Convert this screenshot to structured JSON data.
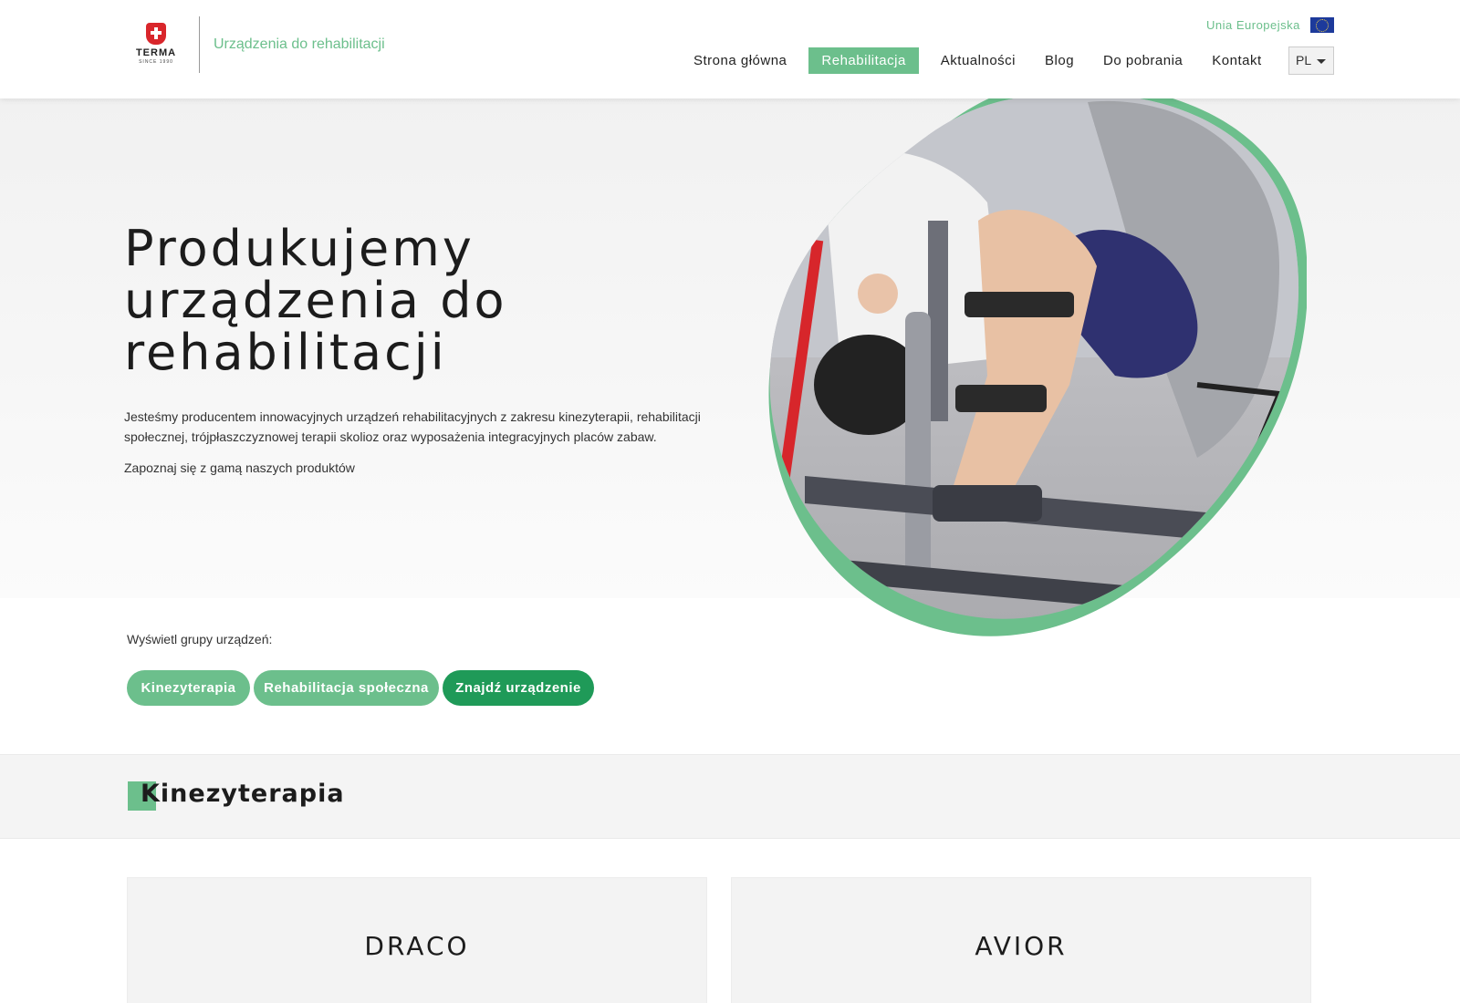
{
  "header": {
    "brand_name": "TERMA",
    "brand_since": "SINCE 1990",
    "subtitle": "Urządzenia do rehabilitacji",
    "eu_link": "Unia Europejska",
    "nav": [
      {
        "label": "Strona główna",
        "active": false
      },
      {
        "label": "Rehabilitacja",
        "active": true
      },
      {
        "label": "Aktualności",
        "active": false
      },
      {
        "label": "Blog",
        "active": false
      },
      {
        "label": "Do pobrania",
        "active": false
      },
      {
        "label": "Kontakt",
        "active": false
      }
    ],
    "language": "PL"
  },
  "hero": {
    "title_lines": [
      "Produkujemy",
      "urządzenia do",
      "rehabilitacji"
    ],
    "description": "Jesteśmy producentem innowacyjnych urządzeń rehabilitacyjnych z zakresu kinezyterapii, rehabilitacji społecznej, trójpłaszczyznowej terapii skolioz oraz wyposażenia integracyjnych placów zabaw.",
    "cta_text": "Zapoznaj się z gamą naszych produktów",
    "image_alt": "rehabilitation-device-photo"
  },
  "groups": {
    "label": "Wyświetl grupy urządzeń:",
    "buttons": [
      {
        "label": "Kinezyterapia",
        "style": "light"
      },
      {
        "label": "Rehabilitacja społeczna",
        "style": "light"
      },
      {
        "label": "Znajdź urządzenie",
        "style": "dark"
      }
    ]
  },
  "section": {
    "title": "Kinezyterapia"
  },
  "products": [
    {
      "name": "DRACO"
    },
    {
      "name": "AVIOR"
    }
  ],
  "colors": {
    "accent": "#6cbf8c",
    "accent_dark": "#1f9a58",
    "brand_red": "#d9262b",
    "eu_blue": "#1d3a9b"
  }
}
